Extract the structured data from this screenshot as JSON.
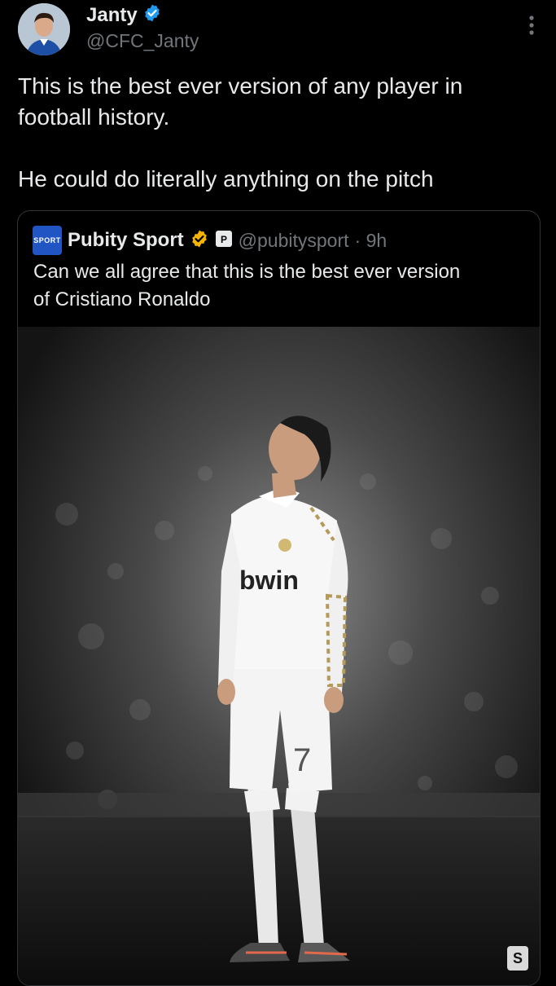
{
  "author": {
    "name": "Janty",
    "handle": "@CFC_Janty",
    "verified": true,
    "verified_color": "#1d9bf0"
  },
  "tweet": {
    "text": "This is the best ever version of any player in\nfootball history.\n\nHe could do literally anything on the pitch"
  },
  "quoted": {
    "logo_text": "SPORT",
    "name": "Pubity Sport",
    "handle": "@pubitysport",
    "time": "· 9h",
    "badge_color": "#f4b400",
    "text": "Can we all agree that this is the best ever version\nof Cristiano Ronaldo",
    "photo": {
      "jersey_sponsor": "bwin",
      "shirt_number": "7",
      "watermark": "S"
    }
  },
  "icons": {
    "more": "more-vertical-icon",
    "verified": "verified-badge-icon",
    "affiliate": "affiliate-badge-icon"
  }
}
